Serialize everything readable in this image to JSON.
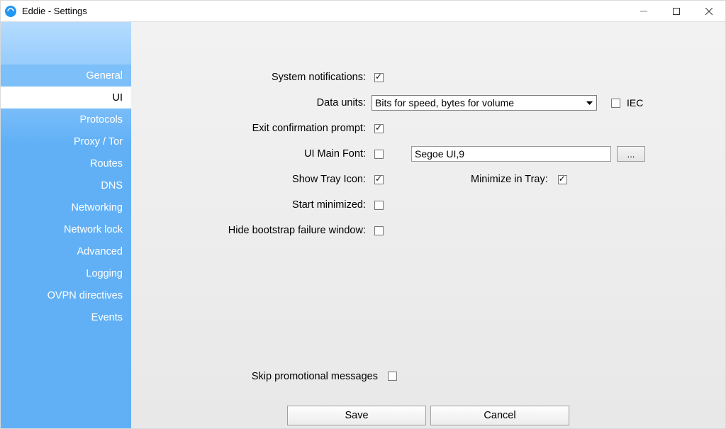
{
  "window": {
    "title": "Eddie - Settings"
  },
  "sidebar": {
    "items": [
      {
        "label": "General",
        "state": "highlight"
      },
      {
        "label": "UI",
        "state": "active"
      },
      {
        "label": "Protocols",
        "state": ""
      },
      {
        "label": "Proxy / Tor",
        "state": ""
      },
      {
        "label": "Routes",
        "state": ""
      },
      {
        "label": "DNS",
        "state": ""
      },
      {
        "label": "Networking",
        "state": ""
      },
      {
        "label": "Network lock",
        "state": ""
      },
      {
        "label": "Advanced",
        "state": ""
      },
      {
        "label": "Logging",
        "state": ""
      },
      {
        "label": "OVPN directives",
        "state": ""
      },
      {
        "label": "Events",
        "state": ""
      }
    ]
  },
  "form": {
    "system_notifications": {
      "label": "System notifications:",
      "checked": true
    },
    "data_units": {
      "label": "Data units:",
      "value": "Bits for speed, bytes for volume"
    },
    "iec": {
      "label": "IEC",
      "checked": false
    },
    "exit_confirm": {
      "label": "Exit confirmation prompt:",
      "checked": true
    },
    "ui_font": {
      "label": "UI Main Font:",
      "checked": false,
      "value": "Segoe UI,9",
      "browse": "..."
    },
    "show_tray": {
      "label": "Show Tray Icon:",
      "checked": true
    },
    "min_in_tray": {
      "label": "Minimize in Tray:",
      "checked": true
    },
    "start_min": {
      "label": "Start minimized:",
      "checked": false
    },
    "hide_bootstrap": {
      "label": "Hide bootstrap failure window:",
      "checked": false
    },
    "skip_promo": {
      "label": "Skip promotional messages",
      "checked": false
    }
  },
  "footer": {
    "save": "Save",
    "cancel": "Cancel"
  }
}
